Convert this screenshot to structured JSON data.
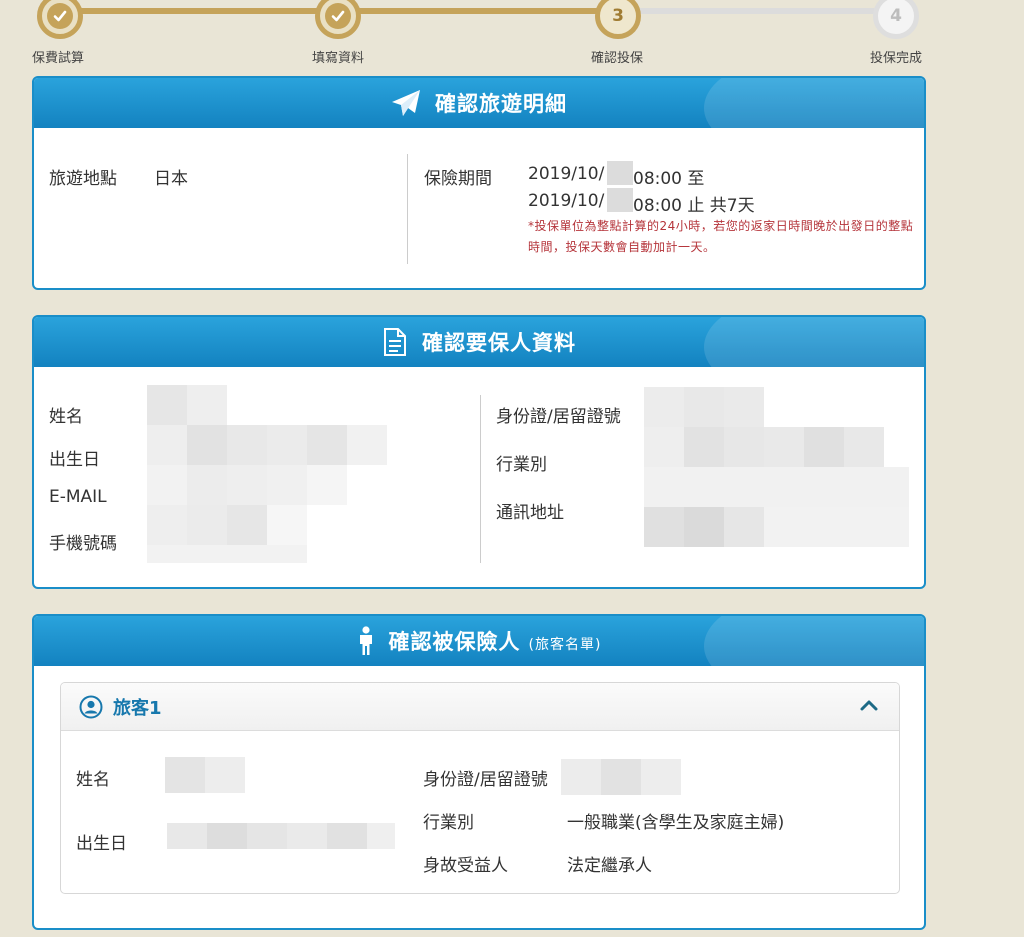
{
  "stepper": {
    "steps": [
      {
        "label": "保費試算",
        "state": "done"
      },
      {
        "label": "填寫資料",
        "state": "done"
      },
      {
        "label": "確認投保",
        "state": "current",
        "number": "3"
      },
      {
        "label": "投保完成",
        "state": "todo",
        "number": "4"
      }
    ]
  },
  "travel_panel": {
    "title": "確認旅遊明細",
    "destination_label": "旅遊地點",
    "destination_value": "日本",
    "period_label": "保險期間",
    "period_start": "2019/10/",
    "period_start_time": "08:00 至",
    "period_end": "2019/10/",
    "period_end_time": "08:00 止 共7天",
    "note": "*投保單位為整點計算的24小時，若您的返家日時間晚於出發日的整點時間，投保天數會自動加計一天。"
  },
  "applicant_panel": {
    "title": "確認要保人資料",
    "name_label": "姓名",
    "birth_label": "出生日",
    "email_label": "E-MAIL",
    "mobile_label": "手機號碼",
    "id_label": "身份證/居留證號",
    "occupation_label": "行業別",
    "address_label": "通訊地址"
  },
  "insured_panel": {
    "title": "確認被保險人",
    "subtitle": "(旅客名單)",
    "traveler": {
      "title": "旅客1",
      "name_label": "姓名",
      "birth_label": "出生日",
      "id_label": "身份證/居留證號",
      "occupation_label": "行業別",
      "occupation_value": "一般職業(含學生及家庭主婦)",
      "beneficiary_label": "身故受益人",
      "beneficiary_value": "法定繼承人"
    }
  },
  "colors": {
    "accent_blue": "#1a8ec8",
    "step_gold": "#c5a35a",
    "note_red": "#b5343a",
    "background": "#e9e5d6"
  },
  "icons": [
    "check-icon",
    "paper-plane-icon",
    "document-icon",
    "person-icon",
    "user-circle-icon",
    "chevron-up-icon"
  ]
}
